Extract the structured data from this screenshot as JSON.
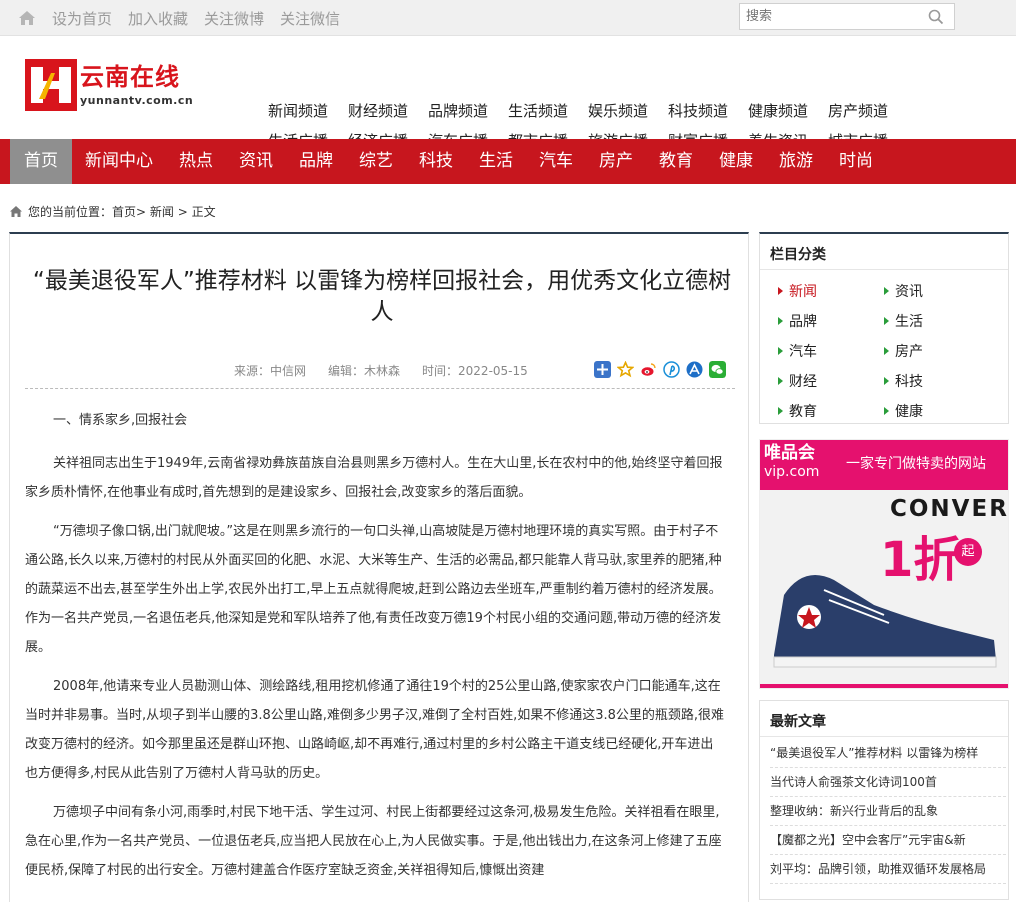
{
  "topbar": {
    "links": [
      "设为首页",
      "加入收藏",
      "关注微博",
      "关注微信"
    ],
    "search_placeholder": "搜索"
  },
  "logo": {
    "cn": "云南在线",
    "en": "yunnantv.com.cn"
  },
  "channels": {
    "row1": [
      "新闻频道",
      "财经频道",
      "品牌频道",
      "生活频道",
      "娱乐频道",
      "科技频道",
      "健康频道",
      "房产频道"
    ],
    "row2": [
      "生活广播",
      "经济广播",
      "汽车广播",
      "都市广播",
      "旅游广播",
      "财富广播",
      "养生资讯",
      "城市广播"
    ]
  },
  "nav": [
    "首页",
    "新闻中心",
    "热点",
    "资讯",
    "品牌",
    "综艺",
    "科技",
    "生活",
    "汽车",
    "房产",
    "教育",
    "健康",
    "旅游",
    "时尚"
  ],
  "breadcrumb": {
    "text": "您的当前位置：",
    "path": "首页> 新闻 > 正文"
  },
  "article": {
    "title": "“最美退役军人”推荐材料 以雷锋为榜样回报社会，用优秀文化立德树人",
    "source": "来源：中信网",
    "editor": "编辑：木林森",
    "time": "时间：2022-05-15",
    "paragraphs": [
      "一、情系家乡,回报社会",
      "关祥祖同志出生于1949年,云南省禄劝彝族苗族自治县则黑乡万德村人。生在大山里,长在农村中的他,始终坚守着回报家乡质朴情怀,在他事业有成时,首先想到的是建设家乡、回报社会,改变家乡的落后面貌。",
      "“万德坝子像口锅,出门就爬坡。”这是在则黑乡流行的一句口头禅,山高坡陡是万德村地理环境的真实写照。由于村子不通公路,长久以来,万德村的村民从外面买回的化肥、水泥、大米等生产、生活的必需品,都只能靠人背马驮,家里养的肥猪,种的蔬菜运不出去,甚至学生外出上学,农民外出打工,早上五点就得爬坡,赶到公路边去坐班车,严重制约着万德村的经济发展。作为一名共产党员,一名退伍老兵,他深知是党和军队培养了他,有责任改变万德19个村民小组的交通问题,带动万德的经济发展。",
      "2008年,他请来专业人员勘测山体、测绘路线,租用挖机修通了通往19个村的25公里山路,使家家农户门口能通车,这在当时并非易事。当时,从坝子到半山腰的3.8公里山路,难倒多少男子汉,难倒了全村百姓,如果不修通这3.8公里的瓶颈路,很难改变万德村的经济。如今那里虽还是群山环抱、山路崎岖,却不再难行,通过村里的乡村公路主干道支线已经硬化,开车进出也方便得多,村民从此告别了万德村人背马驮的历史。",
      "万德坝子中间有条小河,雨季时,村民下地干活、学生过河、村民上街都要经过这条河,极易发生危险。关祥祖看在眼里,急在心里,作为一名共产党员、一位退伍老兵,应当把人民放在心上,为人民做实事。于是,他出钱出力,在这条河上修建了五座便民桥,保障了村民的出行安全。万德村建盖合作医疗室缺乏资金,关祥祖得知后,慷慨出资建"
    ]
  },
  "sidebar": {
    "category_title": "栏目分类",
    "categories": [
      "新闻",
      "资讯",
      "品牌",
      "生活",
      "汽车",
      "房产",
      "财经",
      "科技",
      "教育",
      "健康"
    ],
    "ad": {
      "brand": "唯品会",
      "url": "vip.com",
      "slogan": "一家专门做特卖的网站",
      "product": "CONVERSE",
      "price": "1折",
      "qi": "起"
    },
    "latest_title": "最新文章",
    "latest": [
      "“最美退役军人”推荐材料 以雷锋为榜样",
      "当代诗人俞强茶文化诗词100首",
      "整理收纳：新兴行业背后的乱象",
      "【魔都之光】空中会客厅”元宇宙&新",
      "刘平均：品牌引领，助推双循环发展格局"
    ]
  },
  "colors": {
    "nav_red": "#c7161e",
    "accent_green": "#2a9d3a",
    "ad_pink": "#e5116e"
  }
}
